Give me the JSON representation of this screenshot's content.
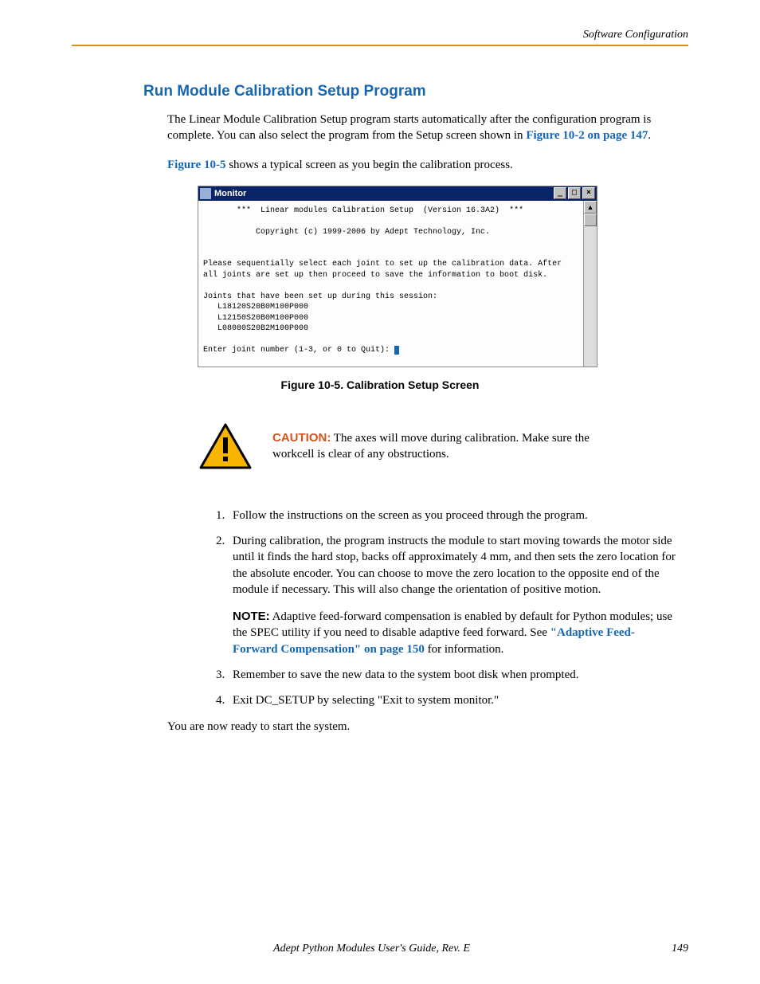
{
  "header": {
    "running_head": "Software Configuration"
  },
  "section": {
    "title": "Run Module Calibration Setup Program",
    "intro_a": "The Linear Module Calibration Setup program starts automatically after the configuration program is complete. You can also select the program from the Setup screen shown in ",
    "intro_link": "Figure 10-2 on page 147",
    "intro_b": ".",
    "lead_a": "Figure 10-5",
    "lead_b": " shows a typical screen as you begin the calibration process."
  },
  "monitor": {
    "title": "Monitor",
    "min_glyph": "_",
    "max_glyph": "□",
    "close_glyph": "×",
    "scroll_up_glyph": "▲",
    "line_header": "       ***  Linear modules Calibration Setup  (Version 16.3A2)  ***",
    "line_copyright": "           Copyright (c) 1999-2006 by Adept Technology, Inc.",
    "line_instr1": "Please sequentially select each joint to set up the calibration data. After",
    "line_instr2": "all joints are set up then proceed to save the information to boot disk.",
    "line_joints": "Joints that have been set up during this session:",
    "line_j1": "   L18120S20B0M100P000",
    "line_j2": "   L12150S20B0M100P000",
    "line_j3": "   L08080S20B2M100P000",
    "line_prompt": "Enter joint number (1-3, or 0 to Quit): "
  },
  "figure": {
    "caption": "Figure 10-5. Calibration Setup Screen"
  },
  "caution": {
    "label": "CAUTION:",
    "text": " The axes will move during calibration. Make sure the workcell is clear of any obstructions."
  },
  "steps": {
    "s1": "Follow the instructions on the screen as you proceed through the program.",
    "s2": "During calibration, the program instructs the module to start moving towards the motor side until it finds the hard stop, backs off approximately 4 mm, and then sets the zero location for the absolute encoder. You can choose to move the zero location to the opposite end of the module if necessary. This will also change the orientation of positive motion.",
    "note_label": "NOTE:",
    "note_a": " Adaptive feed-forward compensation is enabled by default for Python modules; use the SPEC utility if you need to disable adaptive feed forward. See ",
    "note_link": "\"Adaptive Feed-Forward Compensation\" on page 150",
    "note_b": " for information.",
    "s3": "Remember to save the new data to the system boot disk when prompted.",
    "s4": "Exit DC_SETUP by selecting \"Exit to system monitor.\""
  },
  "closing": "You are now ready to start the system.",
  "footer": {
    "doc": "Adept Python Modules User's Guide, Rev. E",
    "page": "149"
  }
}
